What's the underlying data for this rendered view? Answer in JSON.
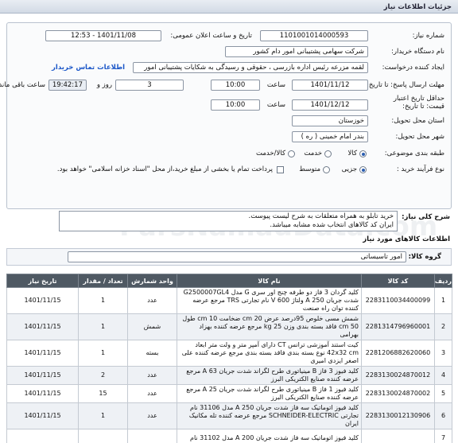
{
  "window": {
    "title": "جزئیات اطلاعات نیاز"
  },
  "form": {
    "need_number": {
      "label": "شماره نیاز:",
      "value": "1101001014000593"
    },
    "announce_datetime": {
      "label": "تاریخ و ساعت اعلان عمومی:",
      "value": "1401/11/08 - 12:53"
    },
    "buyer_name": {
      "label": "نام دستگاه خریدار:",
      "value": "شرکت سهامی پشتیبانی امور دام کشور"
    },
    "creator": {
      "label": "ایجاد کننده درخواست:",
      "value": "لقمه مزرعه رئیس اداره بازرسی ، حقوقی و رسیدگی به شکایات  پشتیبانی امور"
    },
    "buyer_contact_link": "اطلاعات تماس خریدار",
    "reply_deadline": {
      "label": "مهلت ارسال پاسخ: تا تاریخ:",
      "date": "1401/11/12",
      "time_label": "ساعت",
      "time": "10:00",
      "days": "3",
      "days_label": "روز و",
      "remaining": "19:42:17",
      "remaining_label": "ساعت باقی مانده"
    },
    "price_validity": {
      "label_1": "حداقل تاریخ اعتبار",
      "label_2": "قیمت: تا تاریخ:",
      "date": "1401/12/12",
      "time_label": "ساعت",
      "time": "10:00"
    },
    "province": {
      "label": "استان محل تحویل:",
      "value": "خوزستان"
    },
    "city": {
      "label": "شهر محل تحویل:",
      "value": "بندر امام خمینی ( ره )"
    },
    "classification": {
      "label": "طبقه بندی موضوعی:",
      "options": [
        "کالا",
        "خدمت",
        "کالا/خدمت"
      ],
      "selected": "کالا"
    },
    "purchase_type": {
      "label": "نوع فرآیند خرید :",
      "options": [
        "جزیی",
        "متوسط"
      ],
      "selected": "جزیی",
      "note": "پرداخت تمام یا بخشی از مبلغ خرید،از محل \"اسناد خزانه اسلامی\" خواهد بود."
    }
  },
  "description": {
    "label": "شرح کلی نیاز:",
    "line1": "خرید تابلو به همراه متعلقات به شرح لیست پیوست.",
    "line2": "ایران کد کالاهای انتخاب شده مشابه میباشد."
  },
  "goods": {
    "title": "اطلاعات کالاهای مورد نیاز",
    "group_label": "گروه کالا:",
    "group_value": "امور تاسیساتی"
  },
  "table": {
    "headers": [
      "ردیف",
      "کد کالا",
      "نام کالا",
      "واحد شمارش",
      "تعداد / مقدار",
      "تاریخ نیاز"
    ],
    "rows": [
      {
        "no": "1",
        "code": "2283110034400099",
        "name": "کلید گردان 3 فاز دو طرفه چنج اور سری G مدل G2500007GL4 شدت جریان 250 A ولتاژ 600 V نام تجارتی TRS مرجع عرضه کننده توان راه صنعت",
        "unit": "عدد",
        "qty": "1",
        "date": "1401/11/15"
      },
      {
        "no": "2",
        "code": "2281314796960001",
        "name": "شمش مسی خلوص 95درصد عرض 20 cm ضخامت 10 cm طول 50 cm فاقد بسته بندی وزن 25 kg مرجع عرضه کننده بهزاد بهرامی",
        "unit": "شمش",
        "qty": "1",
        "date": "1401/11/15"
      },
      {
        "no": "3",
        "code": "2281206882620060",
        "name": "کیت استند آموزشی ترانس CT دارای آمپر متر و ولت متر ابعاد 42x32 cm نوع بسته بندی فاقد بسته بندی مرجع عرضه کننده علی اصغر ایزدی امیری",
        "unit": "بسته",
        "qty": "1",
        "date": "1401/11/15"
      },
      {
        "no": "4",
        "code": "2283130024870012",
        "name": "کلید فیوز 3 فاز B مینیاتوری طرح لگراند شدت جریان 63 A مرجع عرضه کننده صنایع الکتریکی البرز",
        "unit": "عدد",
        "qty": "2",
        "date": "1401/11/15"
      },
      {
        "no": "5",
        "code": "2283130024870002",
        "name": "کلید فیوز 1 فاز B مینیاتوری طرح لگراند شدت جریان 25 A مرجع عرضه کننده صنایع الکتریکی البرز",
        "unit": "عدد",
        "qty": "15",
        "date": "1401/11/15"
      },
      {
        "no": "6",
        "code": "2283130012130906",
        "name": "کلید فیوز اتوماتیک سه فاز شدت جریان 250 A مدل 31106 نام تجارتی SCHNEIDER-ELECTRIC مرجع عرضه کننده تله مکانیک ایران",
        "unit": "عدد",
        "qty": "1",
        "date": "1401/11/15"
      },
      {
        "no": "7",
        "code": "",
        "name": "کلید فیوز اتوماتیک سه فاز شدت جریان 200 A مدل 31102 نام",
        "unit": "",
        "qty": "",
        "date": ""
      }
    ]
  }
}
